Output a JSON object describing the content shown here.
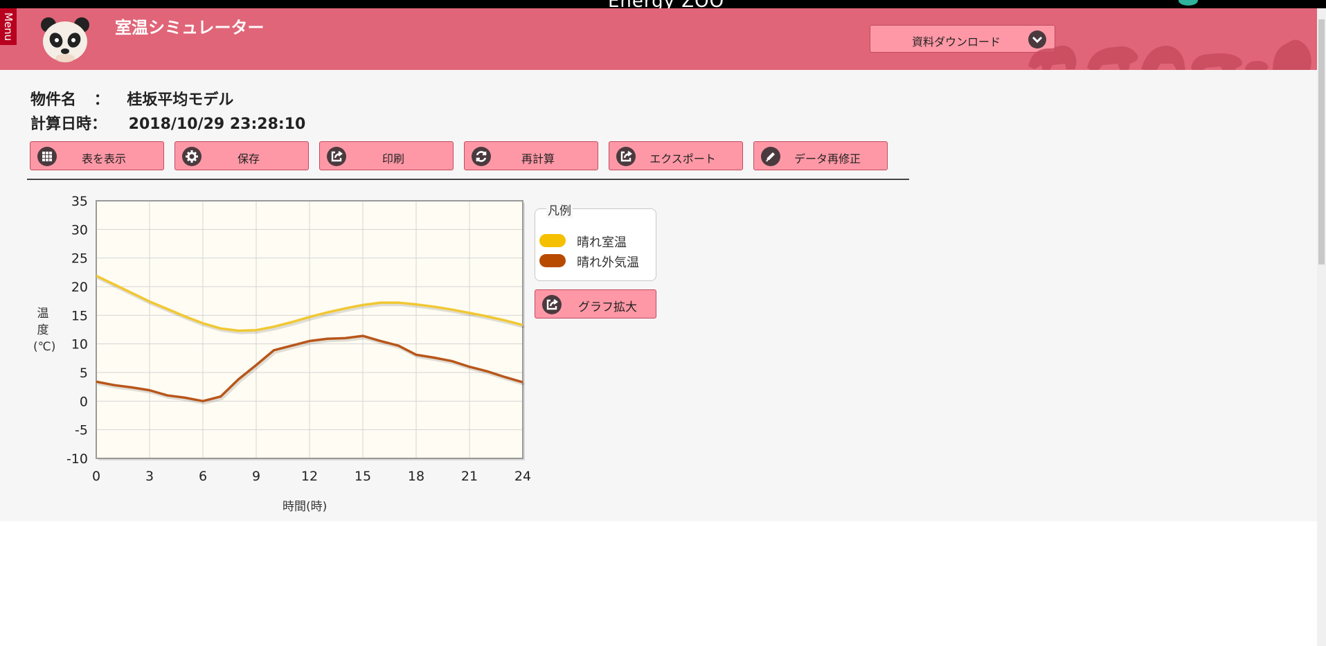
{
  "topbar": {
    "app_name": "Energy ZOO",
    "status_text": ""
  },
  "header": {
    "menu_label": "Menu",
    "title": "室温シミュレーター",
    "download_label": "資料ダウンロード"
  },
  "info": {
    "property_label": "物件名",
    "property_sep": "：",
    "property_value": "桂坂平均モデル",
    "date_label": "計算日時：",
    "date_value": "2018/10/29 23:28:10"
  },
  "toolbar": {
    "buttons": [
      {
        "label": "表を表示",
        "icon": "grid-icon"
      },
      {
        "label": "保存",
        "icon": "gear-icon"
      },
      {
        "label": "印刷",
        "icon": "share-icon"
      },
      {
        "label": "再計算",
        "icon": "refresh-icon"
      },
      {
        "label": "エクスポート",
        "icon": "export-icon"
      },
      {
        "label": "データ再修正",
        "icon": "pencil-icon"
      }
    ]
  },
  "legend": {
    "title": "凡例",
    "items": [
      {
        "label": "晴れ室温",
        "color": "#f5c000"
      },
      {
        "label": "晴れ外気温",
        "color": "#b84a00"
      }
    ]
  },
  "graph_button_label": "グラフ拡大",
  "chart_data": {
    "type": "line",
    "title": "",
    "xlabel": "時間(時)",
    "ylabel": "温度(℃)",
    "xlim": [
      0,
      24
    ],
    "ylim": [
      -10,
      35
    ],
    "xticks": [
      0,
      3,
      6,
      9,
      12,
      15,
      18,
      21,
      24
    ],
    "yticks": [
      35,
      30,
      25,
      20,
      15,
      10,
      5,
      0,
      -5,
      -10
    ],
    "grid": true,
    "x": [
      0,
      1,
      2,
      3,
      4,
      5,
      6,
      7,
      8,
      9,
      10,
      11,
      12,
      13,
      14,
      15,
      16,
      17,
      18,
      19,
      20,
      21,
      22,
      23,
      24
    ],
    "series": [
      {
        "name": "晴れ室温",
        "color": "#f0c832",
        "values": [
          21.9,
          20.4,
          18.9,
          17.4,
          16.1,
          14.8,
          13.6,
          12.7,
          12.3,
          12.4,
          13.0,
          13.8,
          14.7,
          15.5,
          16.2,
          16.8,
          17.2,
          17.2,
          16.9,
          16.5,
          16.0,
          15.4,
          14.8,
          14.1,
          13.3
        ]
      },
      {
        "name": "晴れ外気温",
        "color": "#b8561a",
        "values": [
          3.4,
          2.8,
          2.4,
          1.9,
          1.0,
          0.6,
          0.0,
          0.8,
          3.8,
          6.3,
          8.9,
          9.7,
          10.5,
          10.9,
          11.0,
          11.4,
          10.5,
          9.7,
          8.1,
          7.6,
          7.0,
          6.0,
          5.2,
          4.2,
          3.3
        ]
      }
    ]
  }
}
